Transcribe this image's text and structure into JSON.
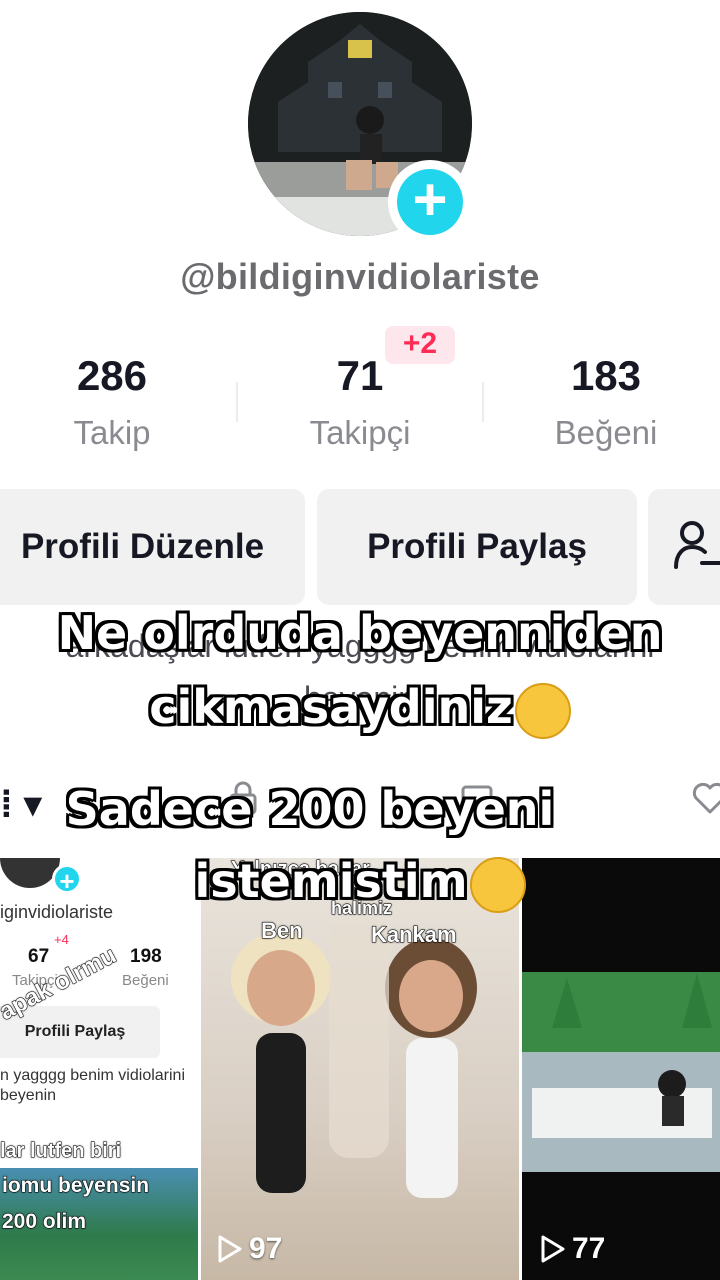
{
  "profile": {
    "username": "@bildiginvidiolariste",
    "avatar_add_icon": "plus-icon"
  },
  "stats": [
    {
      "value": "286",
      "label": "Takip"
    },
    {
      "value": "71",
      "label": "Takipçi",
      "badge": "+2"
    },
    {
      "value": "183",
      "label": "Beğeni"
    }
  ],
  "buttons": {
    "edit": "Profili Düzenle",
    "share": "Profili Paylaş",
    "add_friend_icon": "add-friend-icon"
  },
  "bio": {
    "line1": "arkadaşlar lütfen yagggg benim vidiolarini",
    "line2": "beyenin"
  },
  "tabs": {
    "left": "⁞ ▾",
    "icons": [
      "lock-icon",
      "repost-icon",
      "heart-icon"
    ]
  },
  "captions": {
    "line1": "Ne olrduda beyenniden",
    "line2": "cikmasaydiniz",
    "line3": "Sadece 200 beyeni",
    "line4": "istemistim"
  },
  "videos": [
    {
      "mini_username": "iginvidiolariste",
      "mini_stats": [
        {
          "value": "67",
          "label": "Takipçi",
          "badge": "+4"
        },
        {
          "value": "198",
          "label": "Beğeni"
        }
      ],
      "mini_share": "Profili Paylaş",
      "mini_bio": "n yagggg benim vidiolarini beyenin",
      "overlay_top": "apak olrmu",
      "overlay_mid": "lar lutfen biri",
      "overlay_bot1": "iomu beyensin",
      "overlay_bot2": "200 olim"
    },
    {
      "text_top": "Yalnızca bahar",
      "text_tr": "halimiz",
      "label_ben": "Ben",
      "label_kankam": "Kankam",
      "views": "97"
    },
    {
      "views": "77"
    }
  ],
  "colors": {
    "accent_plus": "#20d5ec",
    "badge_red": "#fe2c55",
    "button_bg": "#f1f1f2"
  }
}
